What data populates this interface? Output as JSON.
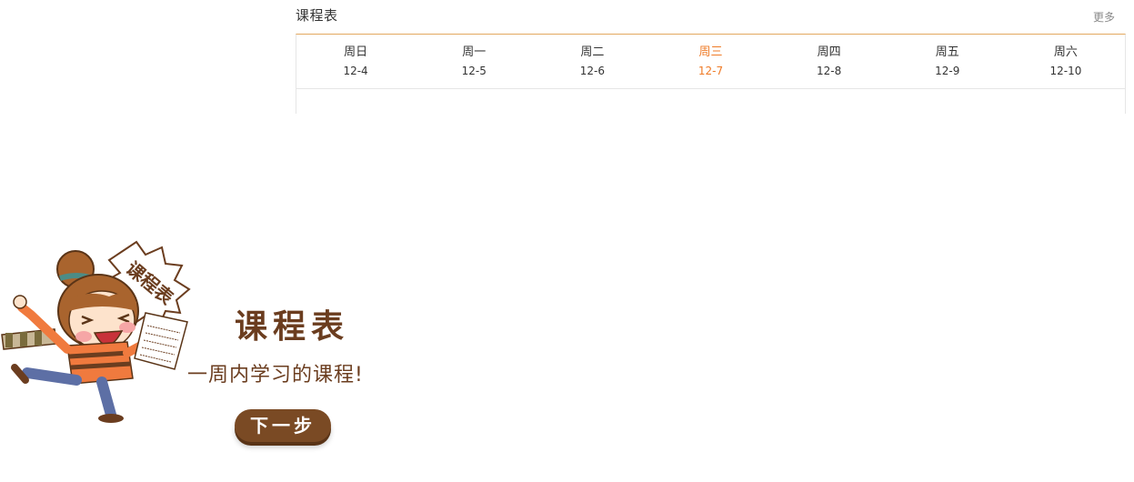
{
  "schedule": {
    "title": "课程表",
    "more_label": "更多",
    "accent_color": "#ef7b27",
    "border_color": "#e3a85f",
    "days": [
      {
        "weekday": "周日",
        "date": "12-4",
        "active": false
      },
      {
        "weekday": "周一",
        "date": "12-5",
        "active": false
      },
      {
        "weekday": "周二",
        "date": "12-6",
        "active": false
      },
      {
        "weekday": "周三",
        "date": "12-7",
        "active": true
      },
      {
        "weekday": "周四",
        "date": "12-8",
        "active": false
      },
      {
        "weekday": "周五",
        "date": "12-9",
        "active": false
      },
      {
        "weekday": "周六",
        "date": "12-10",
        "active": false
      }
    ]
  },
  "intro": {
    "bubble_text": "课程表",
    "title": "课程表",
    "subtitle": "一周内学习的课程!",
    "next_label": "下一步",
    "brand_color": "#6b3d1f"
  }
}
